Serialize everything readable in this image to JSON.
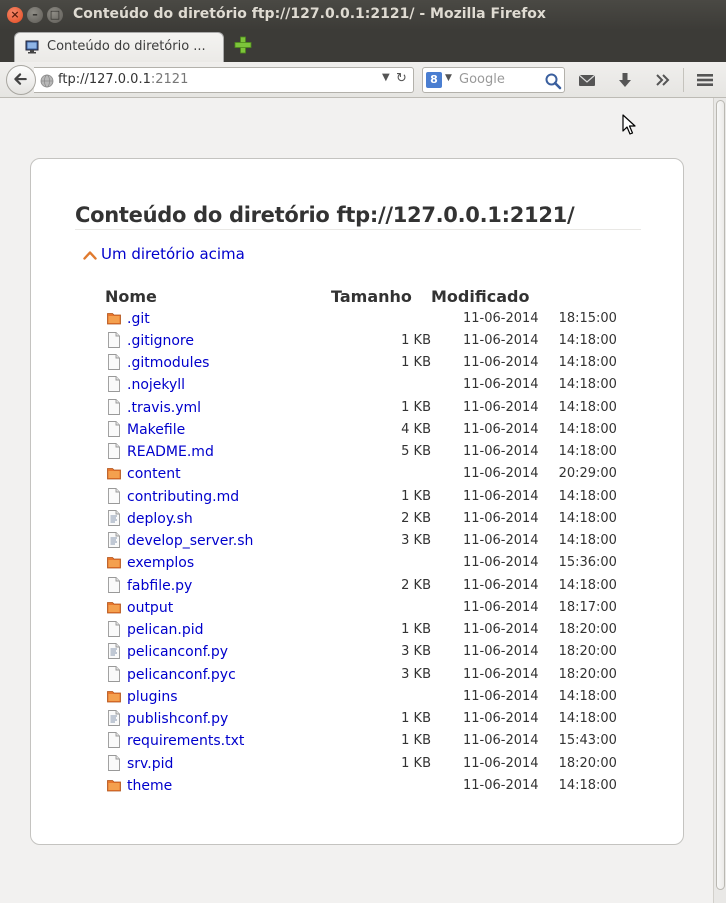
{
  "window": {
    "title": "Conteúdo do diretório ftp://127.0.0.1:2121/ - Mozilla Firefox",
    "close_glyph": "×",
    "minimize_glyph": "–",
    "maximize_glyph": "□"
  },
  "tab": {
    "label": "Conteúdo do diretório ...",
    "favicon": "monitor-icon"
  },
  "nav": {
    "url_scheme_host": "ftp://127.0.0.1",
    "url_port": ":2121",
    "search_engine_letter": "8",
    "search_placeholder": "Google",
    "toolbar_icons": [
      "mail-icon",
      "download-icon",
      "overflow-icon",
      "menu-icon"
    ]
  },
  "page": {
    "heading": "Conteúdo do diretório ftp://127.0.0.1:2121/",
    "up_link": "Um diretório acima",
    "columns": {
      "name": "Nome",
      "size": "Tamanho",
      "modified": "Modificado"
    },
    "entries": [
      {
        "name": ".git",
        "type": "folder",
        "size": "",
        "date": "11-06-2014",
        "time": "18:15:00"
      },
      {
        "name": ".gitignore",
        "type": "file",
        "size": "1 KB",
        "date": "11-06-2014",
        "time": "14:18:00"
      },
      {
        "name": ".gitmodules",
        "type": "file",
        "size": "1 KB",
        "date": "11-06-2014",
        "time": "14:18:00"
      },
      {
        "name": ".nojekyll",
        "type": "file",
        "size": "",
        "date": "11-06-2014",
        "time": "14:18:00"
      },
      {
        "name": ".travis.yml",
        "type": "file",
        "size": "1 KB",
        "date": "11-06-2014",
        "time": "14:18:00"
      },
      {
        "name": "Makefile",
        "type": "file",
        "size": "4 KB",
        "date": "11-06-2014",
        "time": "14:18:00"
      },
      {
        "name": "README.md",
        "type": "file",
        "size": "5 KB",
        "date": "11-06-2014",
        "time": "14:18:00"
      },
      {
        "name": "content",
        "type": "folder",
        "size": "",
        "date": "11-06-2014",
        "time": "20:29:00"
      },
      {
        "name": "contributing.md",
        "type": "file",
        "size": "1 KB",
        "date": "11-06-2014",
        "time": "14:18:00"
      },
      {
        "name": "deploy.sh",
        "type": "script",
        "size": "2 KB",
        "date": "11-06-2014",
        "time": "14:18:00"
      },
      {
        "name": "develop_server.sh",
        "type": "script",
        "size": "3 KB",
        "date": "11-06-2014",
        "time": "14:18:00"
      },
      {
        "name": "exemplos",
        "type": "folder",
        "size": "",
        "date": "11-06-2014",
        "time": "15:36:00"
      },
      {
        "name": "fabfile.py",
        "type": "file",
        "size": "2 KB",
        "date": "11-06-2014",
        "time": "14:18:00"
      },
      {
        "name": "output",
        "type": "folder",
        "size": "",
        "date": "11-06-2014",
        "time": "18:17:00"
      },
      {
        "name": "pelican.pid",
        "type": "file",
        "size": "1 KB",
        "date": "11-06-2014",
        "time": "18:20:00"
      },
      {
        "name": "pelicanconf.py",
        "type": "script",
        "size": "3 KB",
        "date": "11-06-2014",
        "time": "18:20:00"
      },
      {
        "name": "pelicanconf.pyc",
        "type": "file",
        "size": "3 KB",
        "date": "11-06-2014",
        "time": "18:20:00"
      },
      {
        "name": "plugins",
        "type": "folder",
        "size": "",
        "date": "11-06-2014",
        "time": "14:18:00"
      },
      {
        "name": "publishconf.py",
        "type": "script",
        "size": "1 KB",
        "date": "11-06-2014",
        "time": "14:18:00"
      },
      {
        "name": "requirements.txt",
        "type": "file",
        "size": "1 KB",
        "date": "11-06-2014",
        "time": "15:43:00"
      },
      {
        "name": "srv.pid",
        "type": "file",
        "size": "1 KB",
        "date": "11-06-2014",
        "time": "18:20:00"
      },
      {
        "name": "theme",
        "type": "folder",
        "size": "",
        "date": "11-06-2014",
        "time": "14:18:00"
      }
    ]
  },
  "colors": {
    "link": "#0000cc",
    "folder": "#e8762c",
    "titlebar": "#3c3b37"
  }
}
